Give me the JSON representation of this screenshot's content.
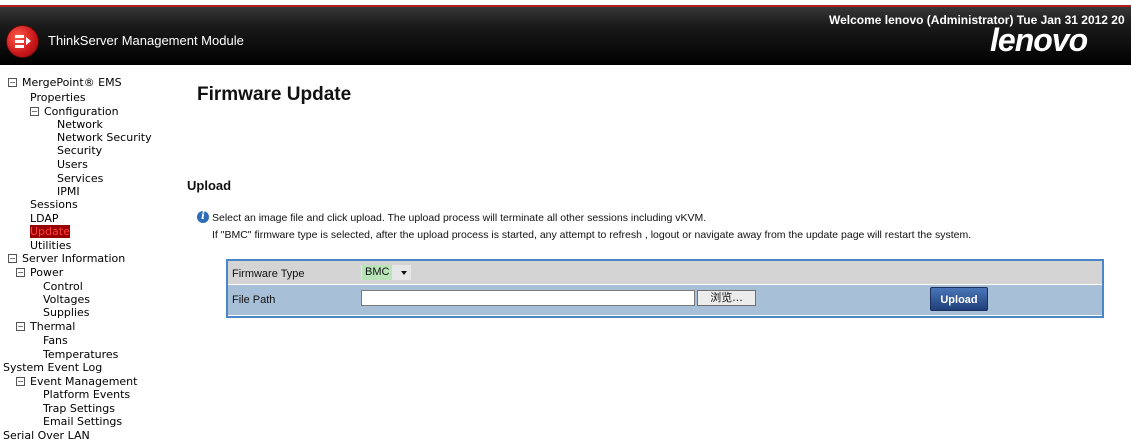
{
  "header": {
    "app_title": "ThinkServer Management Module",
    "welcome": "Welcome lenovo (Administrator) Tue Jan 31 2012 20",
    "brand": "lenovo"
  },
  "sidebar": {
    "items": [
      {
        "label": "MergePoint® EMS",
        "toggle": "⊟"
      },
      {
        "label": "Properties"
      },
      {
        "label": "Configuration",
        "toggle": "⊟"
      },
      {
        "label": "Network"
      },
      {
        "label": "Network Security"
      },
      {
        "label": "Security"
      },
      {
        "label": "Users"
      },
      {
        "label": "Services"
      },
      {
        "label": "IPMI"
      },
      {
        "label": "Sessions"
      },
      {
        "label": "LDAP"
      },
      {
        "label": "Update"
      },
      {
        "label": "Utilities"
      },
      {
        "label": "Server Information",
        "toggle": "⊟"
      },
      {
        "label": "Power",
        "toggle": "⊟"
      },
      {
        "label": "Control"
      },
      {
        "label": "Voltages"
      },
      {
        "label": "Supplies"
      },
      {
        "label": "Thermal",
        "toggle": "⊟"
      },
      {
        "label": "Fans"
      },
      {
        "label": "Temperatures"
      },
      {
        "label": "System Event Log"
      },
      {
        "label": "Event Management",
        "toggle": "⊟"
      },
      {
        "label": "Platform Events"
      },
      {
        "label": "Trap Settings"
      },
      {
        "label": "Email Settings"
      },
      {
        "label": "Serial Over LAN"
      }
    ]
  },
  "main": {
    "page_title": "Firmware Update",
    "section_title": "Upload",
    "info_line1": "Select an image file and click upload. The upload process will terminate all other sessions including vKVM.",
    "info_line2": "If \"BMC\" firmware type is selected, after the upload process is started, any attempt to refresh , logout or navigate away from the update page will restart the system.",
    "form": {
      "firmware_type_label": "Firmware Type",
      "firmware_type_value": "BMC",
      "file_path_label": "File Path",
      "file_path_value": "",
      "browse_label": "浏览...",
      "upload_label": "Upload"
    }
  },
  "colors": {
    "header_bg": "#000000",
    "active_nav_bg": "#990000",
    "form_border": "#4a86c8",
    "row_grey": "#d4d4d4",
    "row_blue": "#a7c0d8",
    "upload_button": "#2a4f8f"
  }
}
